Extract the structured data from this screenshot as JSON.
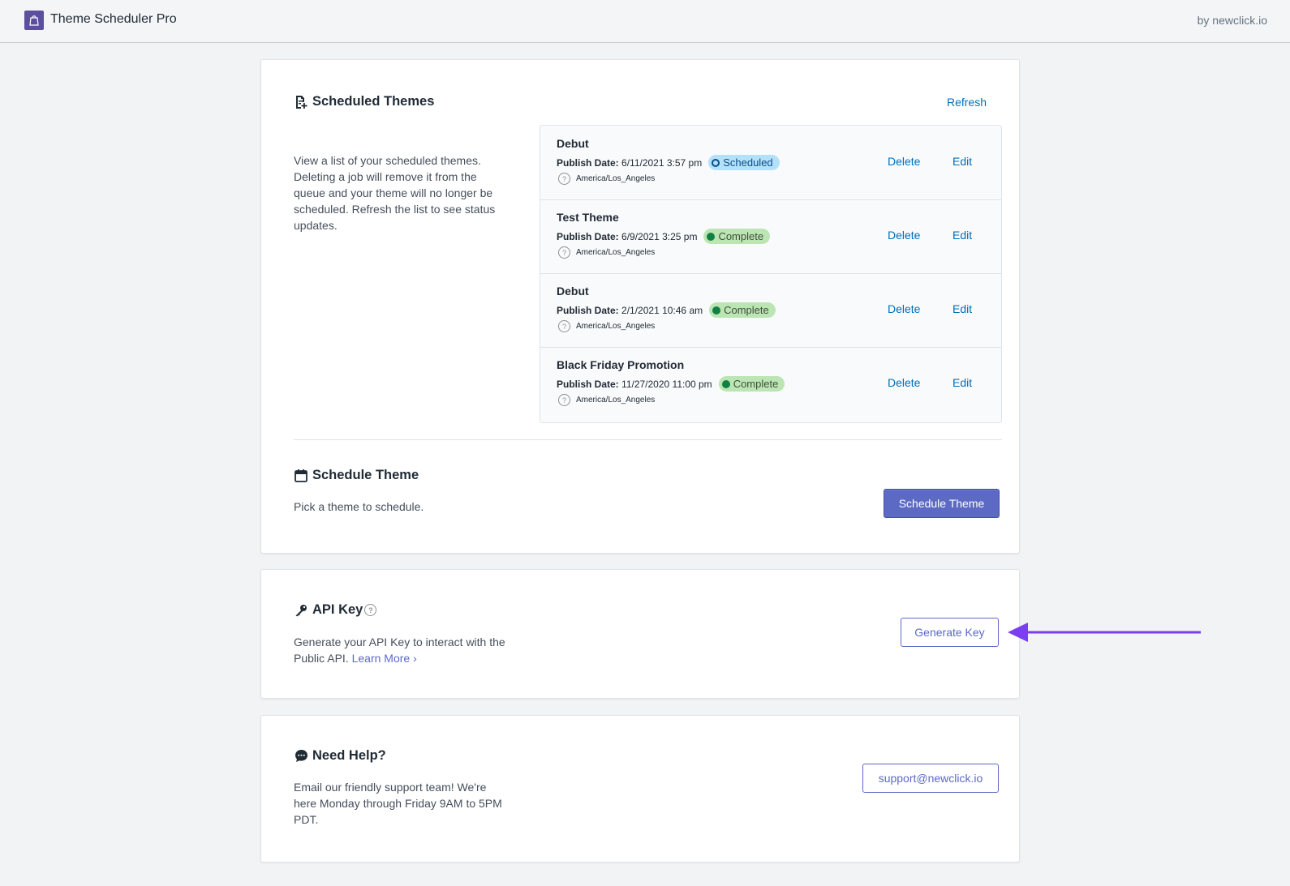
{
  "header": {
    "app_title": "Theme Scheduler Pro",
    "by_text": "by newclick.io",
    "logo_icon": "shopify-bag-icon"
  },
  "scheduled_themes": {
    "title": "Scheduled Themes",
    "icon": "document-plus-icon",
    "refresh_label": "Refresh",
    "description": "View a list of your scheduled themes. Deleting a job will remove it from the queue and your theme will no longer be scheduled. Refresh the list to see status updates.",
    "publish_date_label": "Publish Date:",
    "delete_label": "Delete",
    "edit_label": "Edit",
    "items": [
      {
        "name": "Debut",
        "date": "6/11/2021 3:57 pm",
        "status": "Scheduled",
        "timezone": "America/Los_Angeles"
      },
      {
        "name": "Test Theme",
        "date": "6/9/2021 3:25 pm",
        "status": "Complete",
        "timezone": "America/Los_Angeles"
      },
      {
        "name": "Debut",
        "date": "2/1/2021 10:46 am",
        "status": "Complete",
        "timezone": "America/Los_Angeles"
      },
      {
        "name": "Black Friday Promotion",
        "date": "11/27/2020 11:00 pm",
        "status": "Complete",
        "timezone": "America/Los_Angeles"
      }
    ]
  },
  "schedule_theme": {
    "title": "Schedule Theme",
    "icon": "calendar-icon",
    "description": "Pick a theme to schedule.",
    "button_label": "Schedule Theme"
  },
  "api_key": {
    "title": "API Key",
    "icon": "key-icon",
    "description": "Generate your API Key to interact with the Public API.",
    "learn_more": "Learn More ›",
    "button_label": "Generate Key"
  },
  "help": {
    "title": "Need Help?",
    "icon": "chat-bubble-icon",
    "description": "Email our friendly support team! We're here Monday through Friday 9AM to 5PM PDT.",
    "email_button": "support@newclick.io"
  },
  "colors": {
    "primary": "#5c6ac4",
    "link": "#006fbb",
    "scheduled_badge": "#b4e1fa",
    "complete_badge": "#bbe5b3",
    "annotation_arrow": "#7b3ff2"
  }
}
